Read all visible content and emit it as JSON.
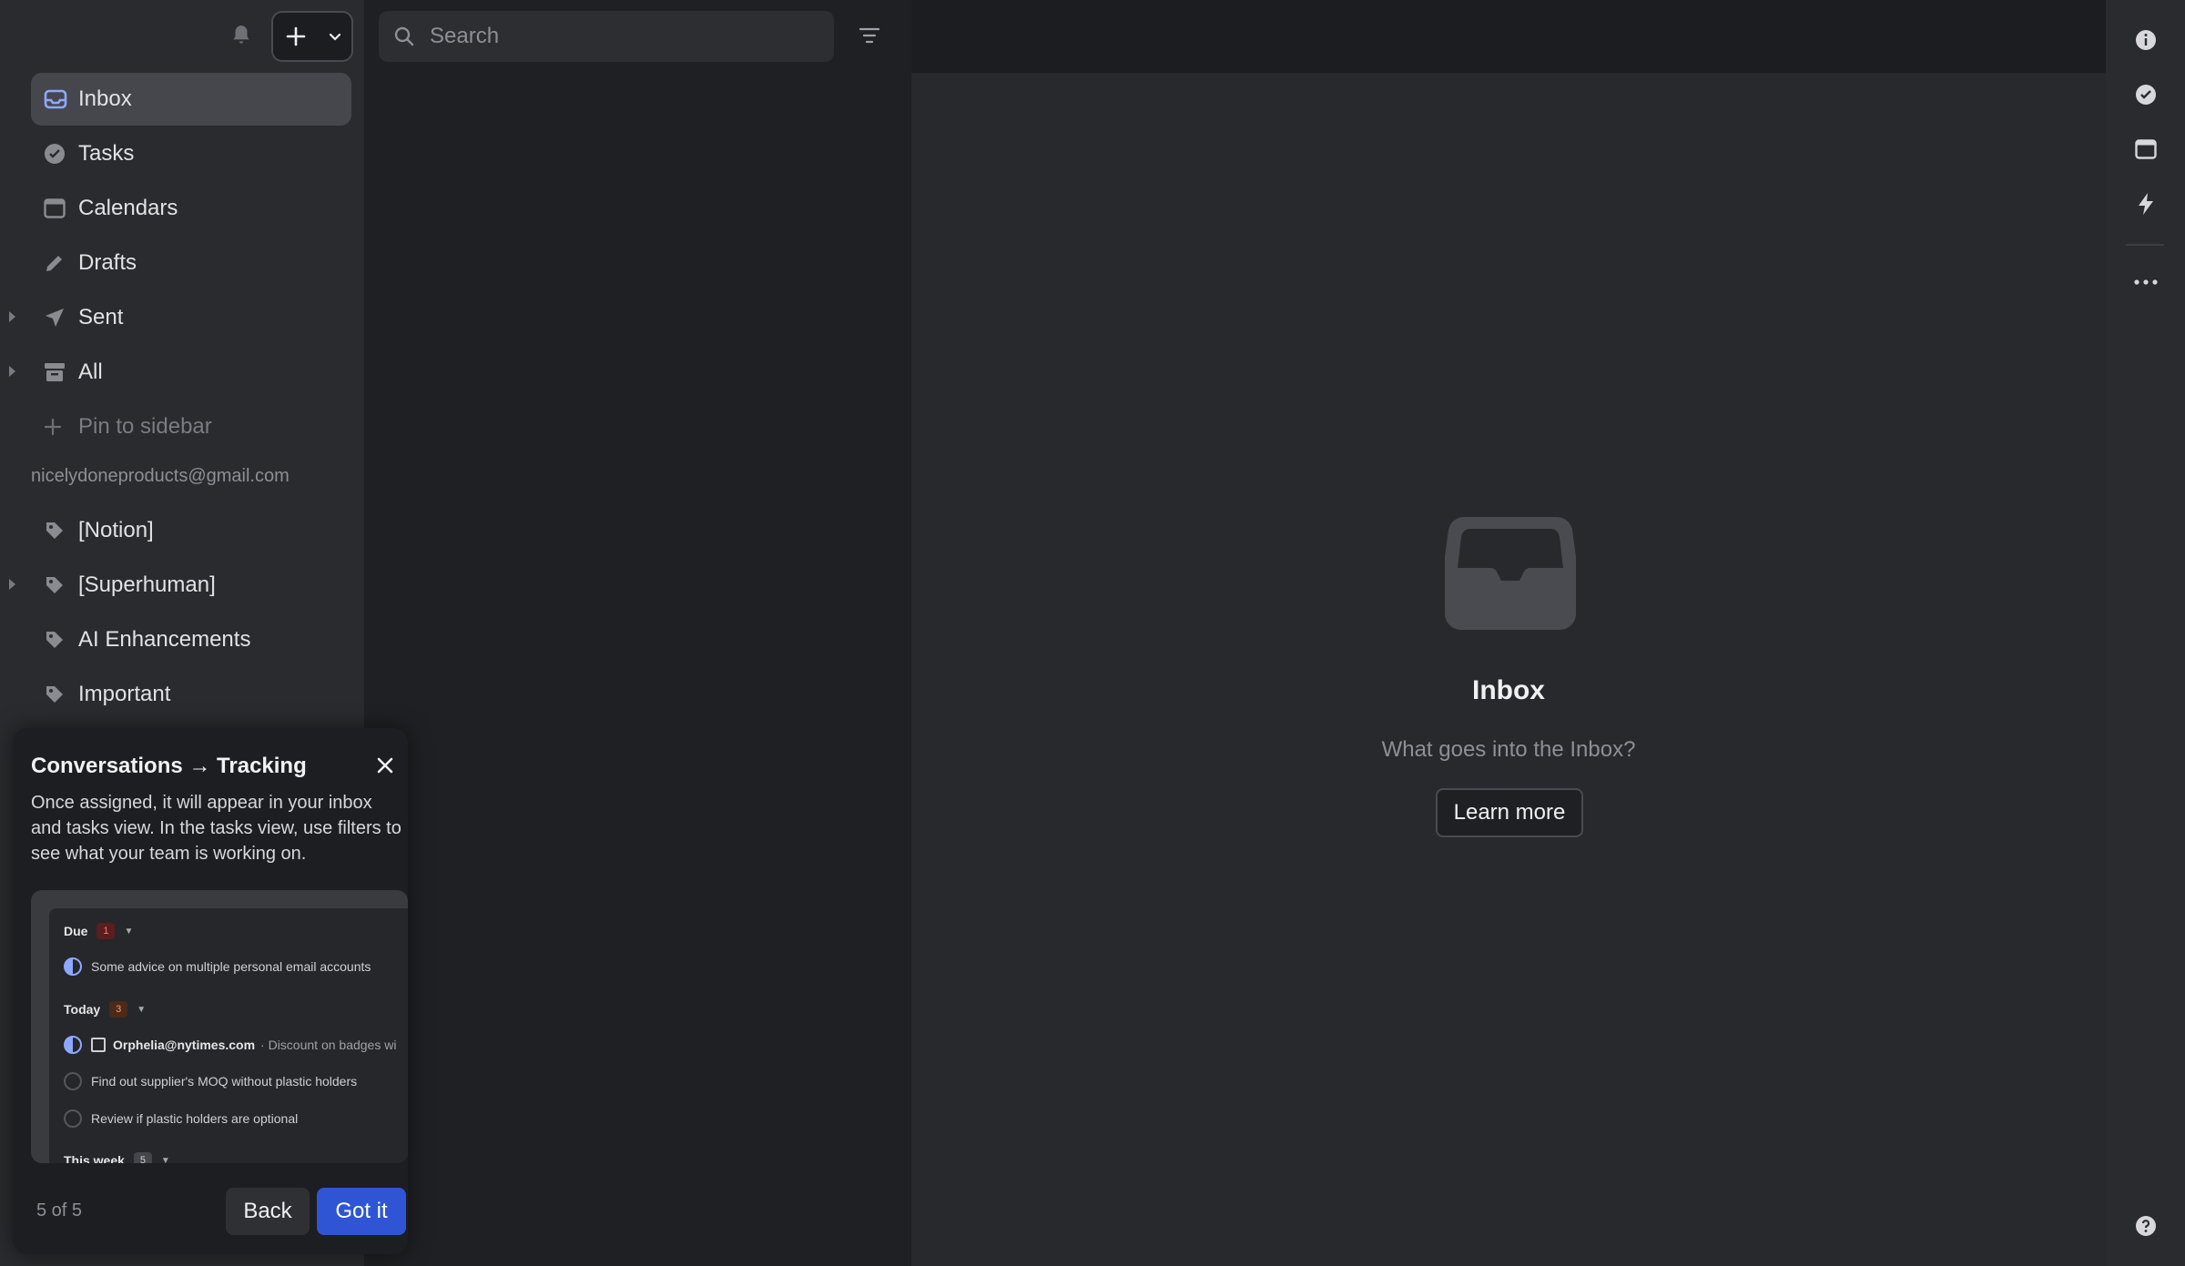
{
  "sidebar": {
    "nav": [
      {
        "label": "Inbox",
        "icon": "inbox-icon",
        "active": true,
        "expandable": false
      },
      {
        "label": "Tasks",
        "icon": "check-circle-icon",
        "active": false,
        "expandable": false
      },
      {
        "label": "Calendars",
        "icon": "calendar-icon",
        "active": false,
        "expandable": false
      },
      {
        "label": "Drafts",
        "icon": "pencil-icon",
        "active": false,
        "expandable": false
      },
      {
        "label": "Sent",
        "icon": "paper-plane-icon",
        "active": false,
        "expandable": true
      },
      {
        "label": "All",
        "icon": "archive-icon",
        "active": false,
        "expandable": true
      }
    ],
    "pin_label": "Pin to sidebar",
    "account": "nicelydoneproducts@gmail.com",
    "labels": [
      {
        "label": "[Notion]",
        "expandable": false
      },
      {
        "label": "[Superhuman]",
        "expandable": true
      },
      {
        "label": "AI Enhancements",
        "expandable": false
      },
      {
        "label": "Important",
        "expandable": false
      }
    ]
  },
  "tour": {
    "title": "Conversations → Tracking",
    "body": "Once assigned, it will appear in your inbox and tasks view. In the tasks view, use filters to see what your team is working on.",
    "preview": {
      "due_label": "Due",
      "due_count": "1",
      "due_item": "Some advice on multiple personal email accounts",
      "today_label": "Today",
      "today_count": "3",
      "today_sender": "Orphelia@nytimes.com",
      "today_subject": "· Discount on badges wi",
      "today_items": [
        "Find out supplier's MOQ without plastic holders",
        "Review if plastic holders are optional"
      ],
      "week_label": "This week",
      "week_count": "5"
    },
    "step": "5 of 5",
    "back_label": "Back",
    "got_label": "Got it"
  },
  "search": {
    "placeholder": "Search"
  },
  "detail": {
    "title": "Inbox",
    "subtitle": "What goes into the Inbox?",
    "learn_label": "Learn more"
  },
  "colors": {
    "accent": "#2f55d4",
    "inbox_icon": "#8fa8ff"
  }
}
